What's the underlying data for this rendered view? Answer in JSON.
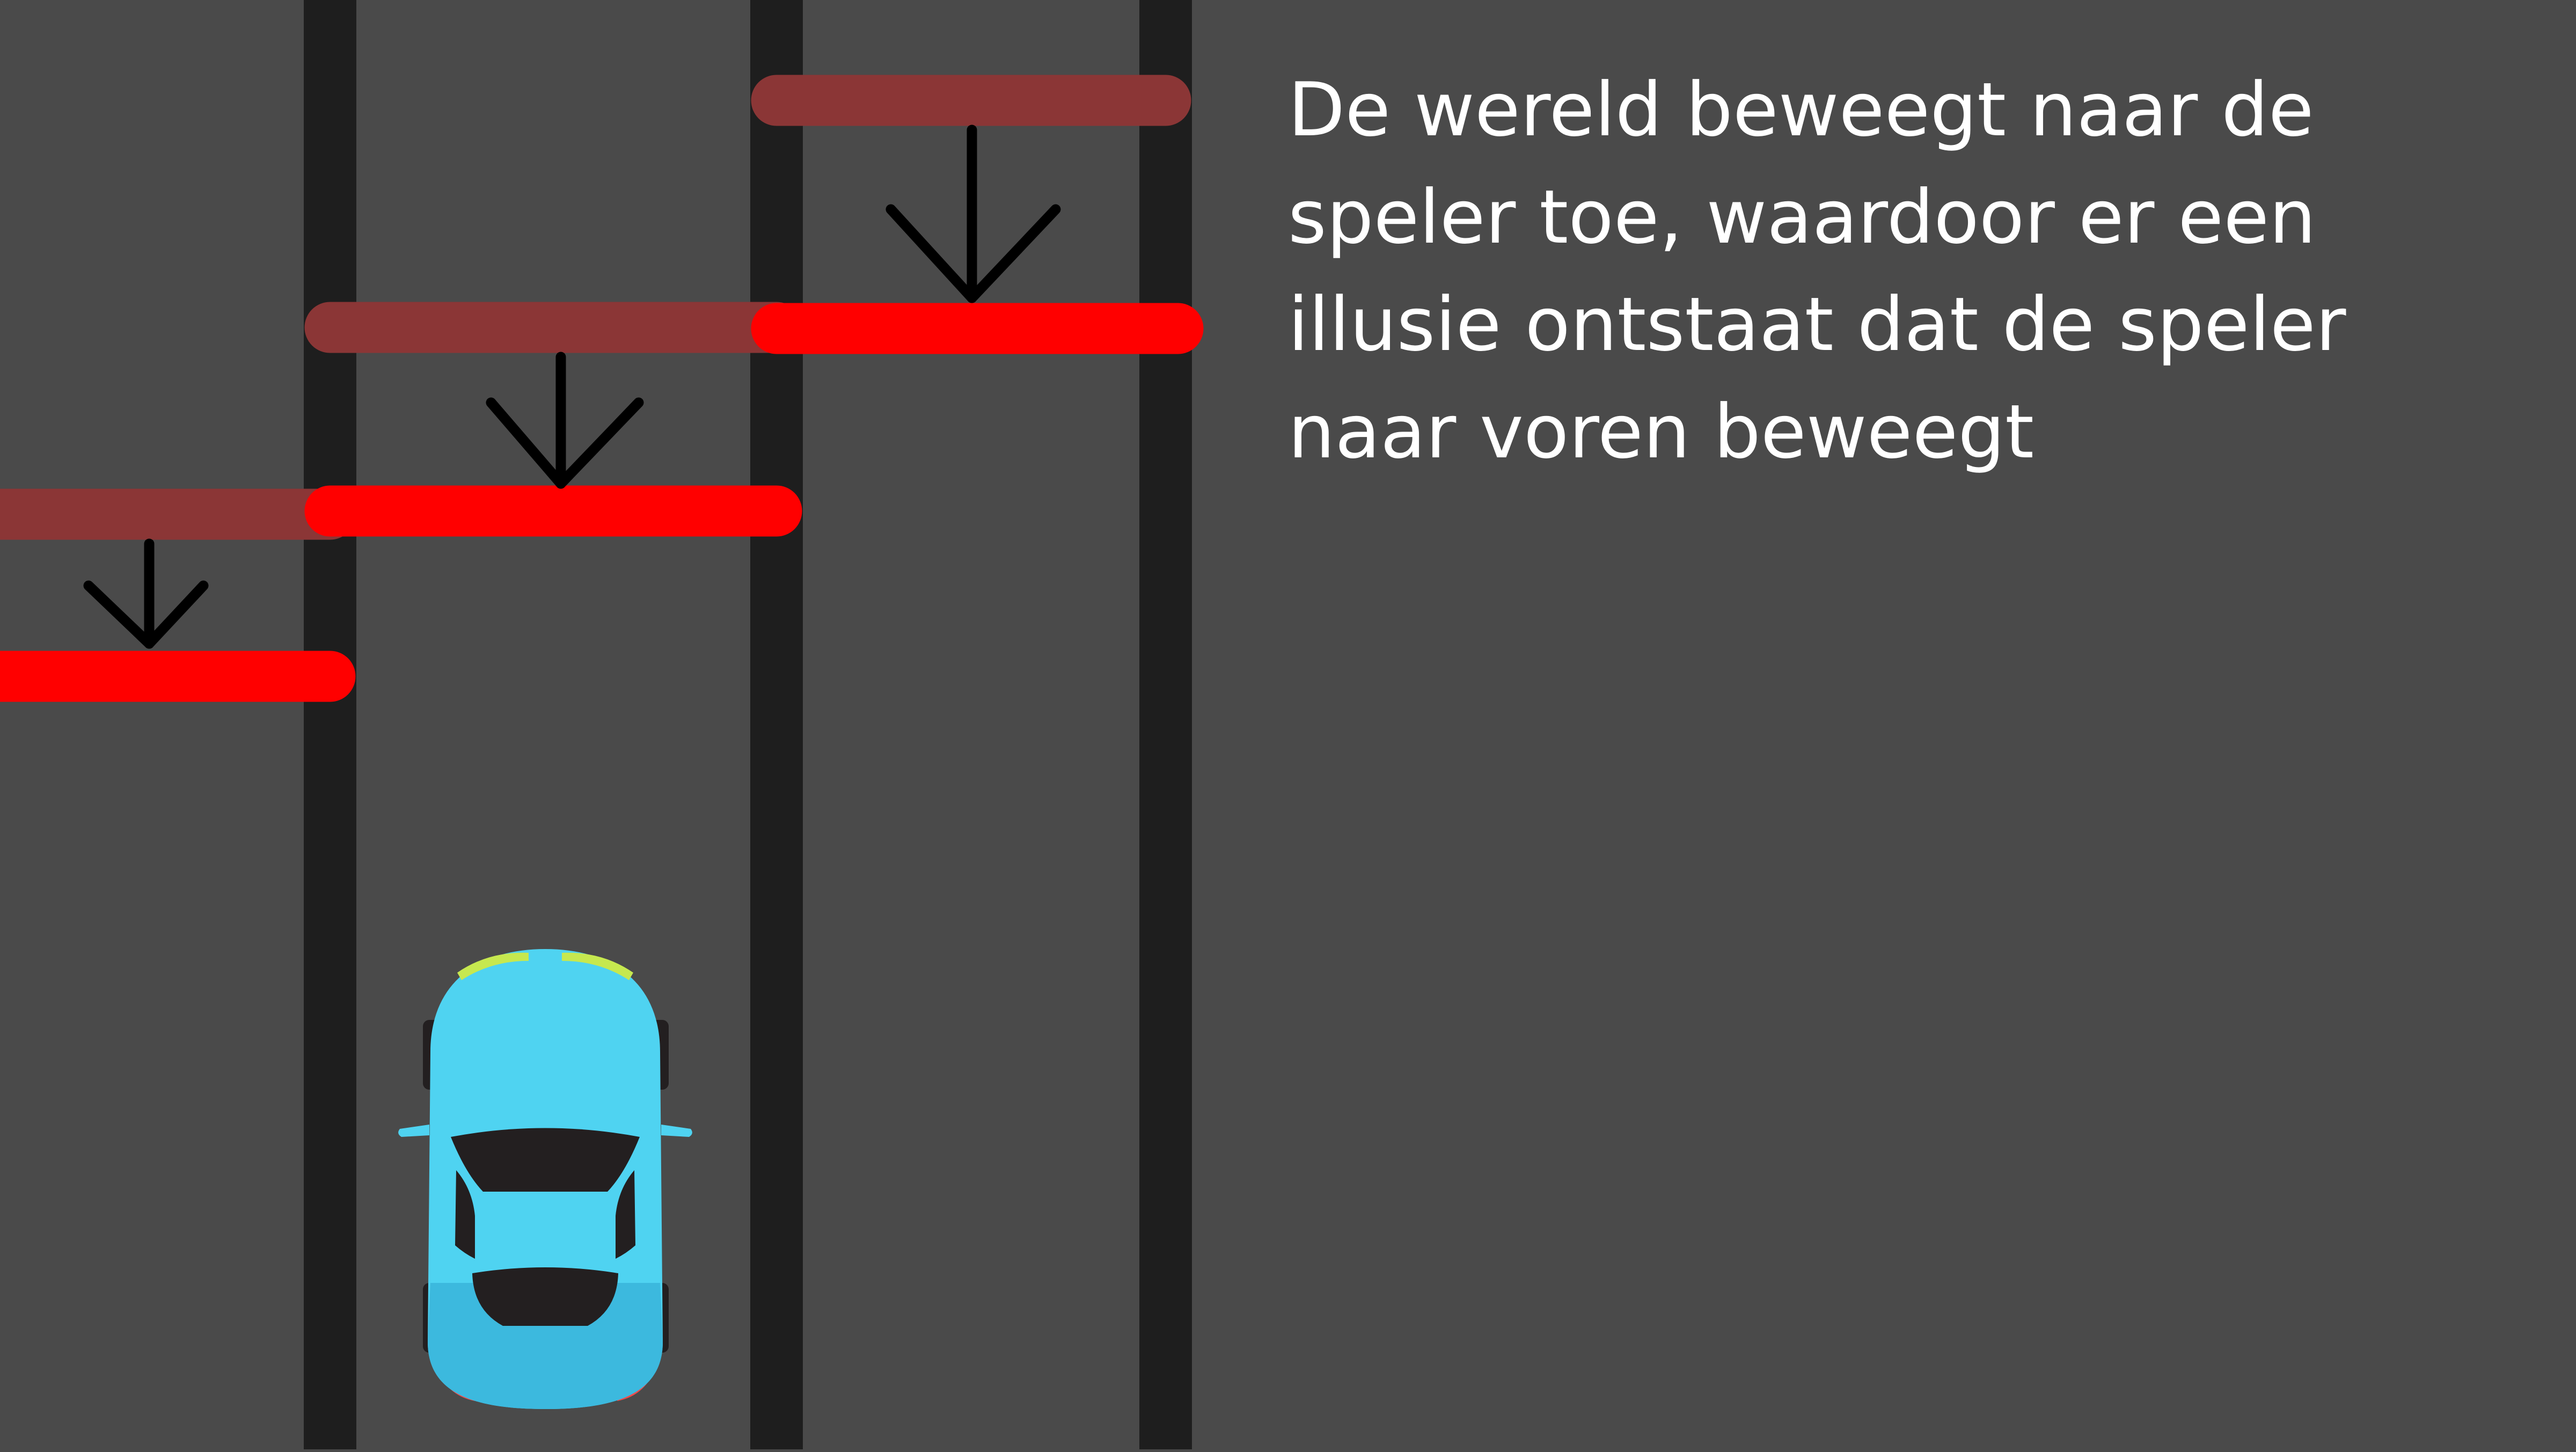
{
  "caption": {
    "lines": [
      "De wereld beweegt naar de",
      "speler toe, waardoor er een",
      "illusie ontstaat dat de speler",
      "naar voren beweegt"
    ]
  },
  "colors": {
    "background": "#4a4a4a",
    "lane_line": "#1e1e1e",
    "obstacle": "#ff0000",
    "obstacle_previous": "#8b3636",
    "arrow": "#000000",
    "car_body": "#4fd3f1",
    "car_body_shade": "#3cb9de",
    "car_window": "#231f20",
    "car_headlight": "#c6e84f",
    "car_taillight": "#ef4b4b",
    "caption_text": "#ffffff"
  },
  "icons": {
    "player": "car-topdown-icon",
    "movement": "arrow-down-icon"
  }
}
